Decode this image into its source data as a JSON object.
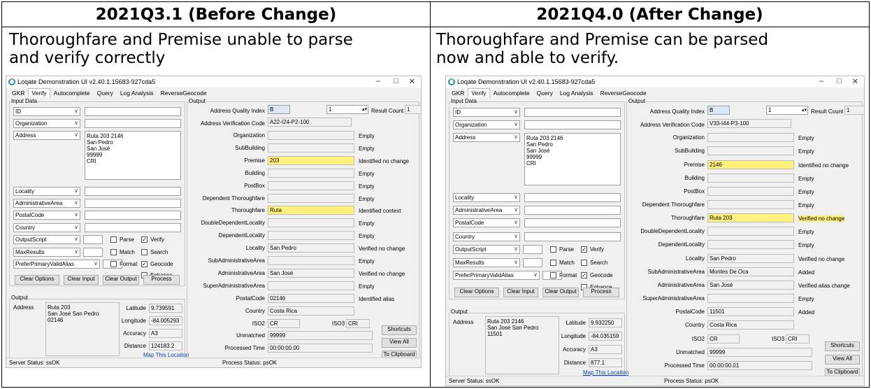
{
  "headers": {
    "left": "2021Q3.1 (Before Change)",
    "right": "2021Q4.0 (After Change)"
  },
  "captions": {
    "left_line1": "Thoroughfare and Premise unable to parse",
    "left_line2": "and verify correctly",
    "right_line1": "Thoroughfare and Premise can be parsed",
    "right_line2": "now and able to verify."
  },
  "app": {
    "title": "Loqate Demonstration UI v2.40.1.15683-927cda5",
    "tabs": [
      "GKR",
      "Verify",
      "Autocomplete",
      "Query",
      "Log Analysis",
      "ReverseGeocode"
    ],
    "input_data_label": "Input Data",
    "output_label": "Output",
    "combos": [
      "ID",
      "Organization",
      "Address",
      "Locality",
      "AdministrativeArea",
      "PostalCode",
      "Country",
      "OutputScript",
      "MaxResults",
      "PreferPrimaryValidAlias"
    ],
    "address_lines": [
      "Ruta 203 2146",
      "San Pedro",
      "San José",
      "99999",
      "CRI"
    ],
    "checkboxes": [
      "Parse",
      "Verify",
      "Match",
      "Search",
      "Format",
      "Geocode",
      "Enhance"
    ],
    "buttons": {
      "clear_options": "Clear Options",
      "clear_input": "Clear Input",
      "clear_output": "Clear Output",
      "process": "Process",
      "shortcuts": "Shortcuts",
      "view_all": "View All",
      "to_clipboard": "To Clipboard"
    },
    "aqi_label": "Address Quality Index",
    "result_count_label": "Result Count",
    "avc_label": "Address Verification Code",
    "field_labels": [
      "Organization",
      "SubBuilding",
      "Premise",
      "Building",
      "PostBox",
      "Dependent Thoroughfare",
      "Thoroughfare",
      "DoubleDependentLocality",
      "DependentLocality",
      "Locality",
      "SubAdministrativeArea",
      "AdministrativeArea",
      "SuperAdministrativeArea",
      "PostalCode",
      "Country"
    ],
    "iso2_label": "ISO2",
    "iso3_label": "ISO3",
    "unmatched_label": "Unmatched",
    "processed_time_label": "Processed Time",
    "address_label": "Address",
    "latitude_label": "Latitude",
    "longitude_label": "Longitude",
    "accuracy_label": "Accuracy",
    "distance_label": "Distance",
    "map_link": "Map This Location",
    "server_status": "Server Status: ssOK",
    "process_status": "Process Status: psOK"
  },
  "before": {
    "aqi": "B",
    "spin": "1",
    "result_count": "1",
    "avc": "A22-I24-P2-100",
    "values": [
      "",
      "",
      "203",
      "",
      "",
      "",
      "Ruta",
      "",
      "",
      "San Pedro",
      "",
      "San José",
      "",
      "02146",
      "Costa Rica"
    ],
    "statuses": [
      "Empty",
      "Empty",
      "Identified no change",
      "Empty",
      "Empty",
      "Empty",
      "Identified context",
      "Empty",
      "Empty",
      "Verified no change",
      "Empty",
      "Verified no change",
      "Empty",
      "Identified alias",
      ""
    ],
    "iso2": "CR",
    "iso3": "CRI",
    "unmatched": "99999",
    "processed_time": "00:00:00.00",
    "out_address": [
      "Ruta 203",
      "San José San Pedro",
      "02146"
    ],
    "latitude": "9.739591",
    "longitude": "-84.005293",
    "accuracy": "A3",
    "distance": "124183.2"
  },
  "after": {
    "aqi": "B",
    "spin": "1",
    "result_count": "1",
    "avc": "V33-I44-P3-100",
    "values": [
      "",
      "",
      "2146",
      "",
      "",
      "",
      "Ruta 203",
      "",
      "",
      "San Pedro",
      "Montes De Oca",
      "San José",
      "",
      "11501",
      "Costa Rica"
    ],
    "statuses": [
      "Empty",
      "Empty",
      "Identified no change",
      "Empty",
      "Empty",
      "Empty",
      "Verified no change",
      "Empty",
      "Empty",
      "Verified no change",
      "Added",
      "Verified alias change",
      "Empty",
      "Added",
      ""
    ],
    "iso2": "CR",
    "iso3": "CRI",
    "unmatched": "99999",
    "processed_time": "00:00:00.01",
    "out_address": [
      "Ruta 203 2146",
      "San José San Pedro",
      "11501"
    ],
    "latitude": "9.932250",
    "longitude": "-84.035159",
    "accuracy": "A3",
    "distance": "877.1"
  }
}
